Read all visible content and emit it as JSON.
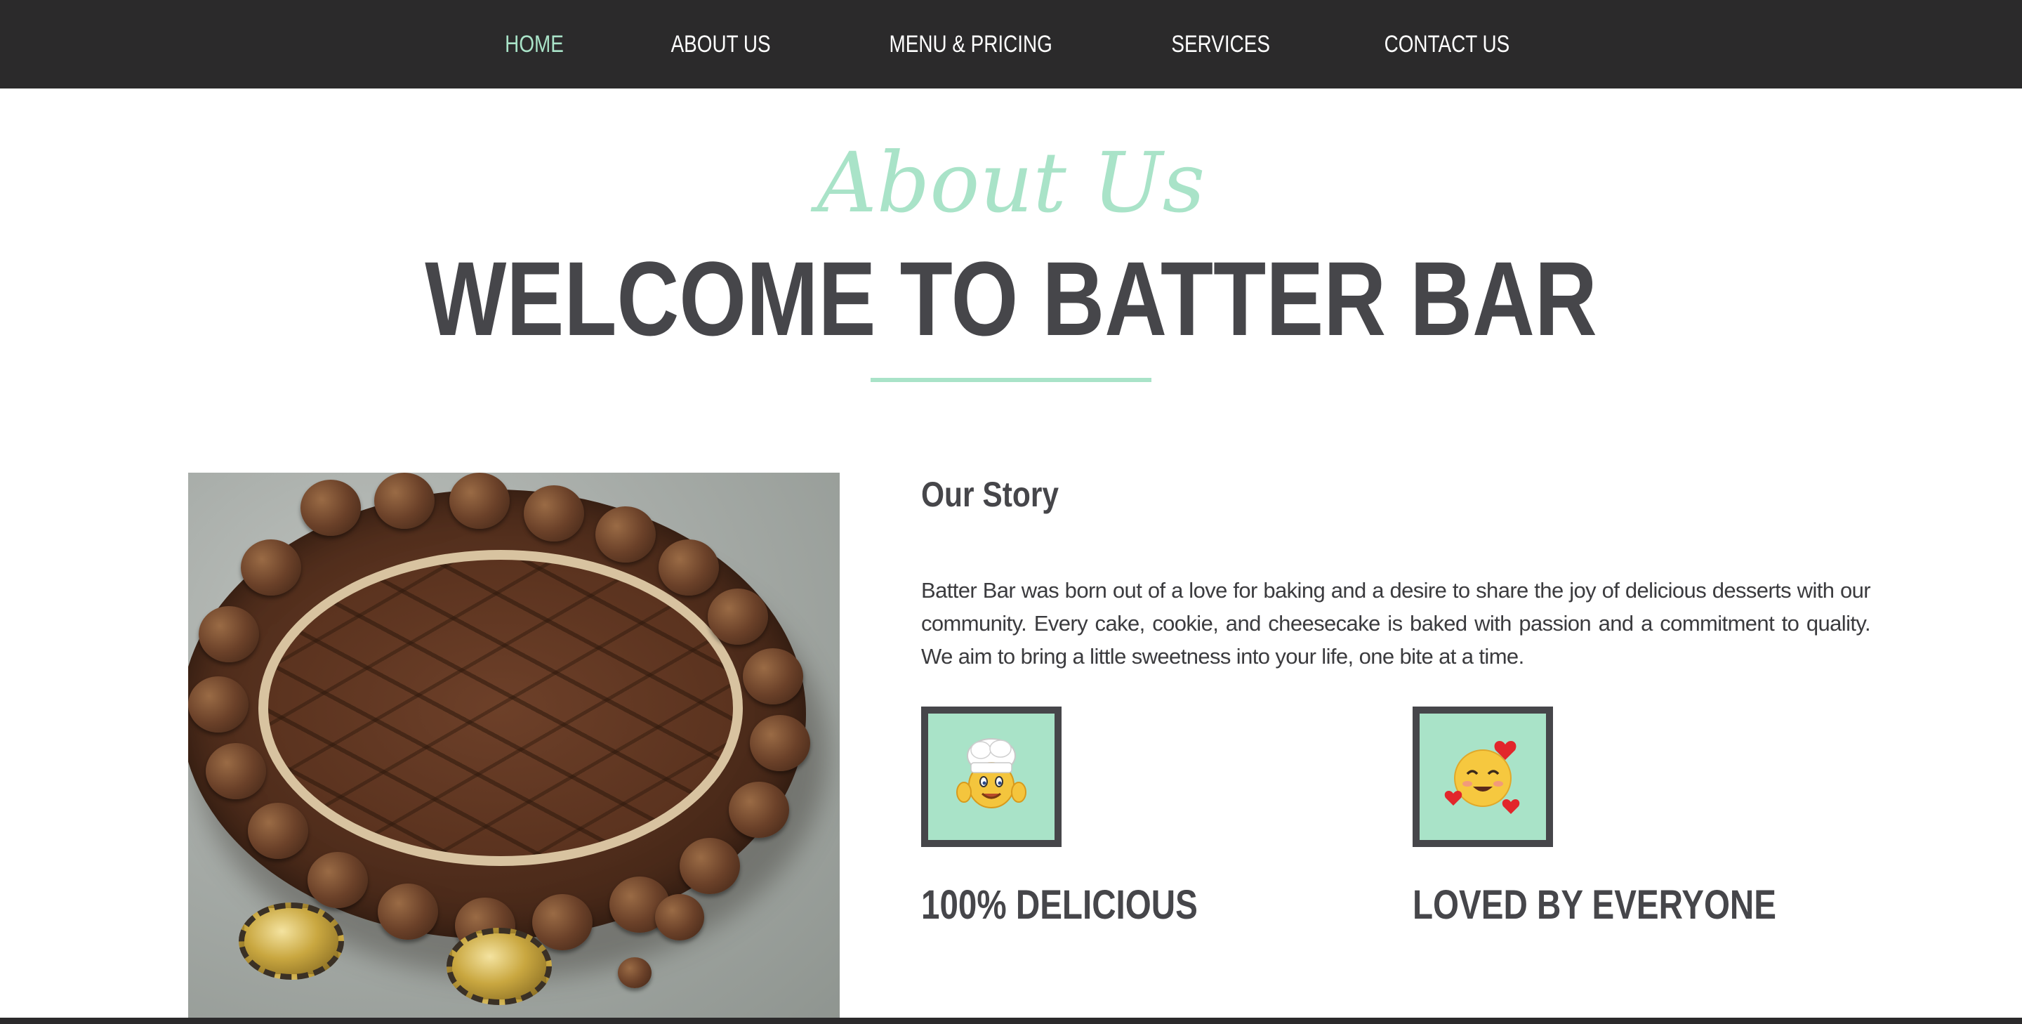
{
  "nav": {
    "items": [
      {
        "label": "HOME",
        "active": true
      },
      {
        "label": "ABOUT US",
        "active": false
      },
      {
        "label": "MENU & PRICING",
        "active": false
      },
      {
        "label": "SERVICES",
        "active": false
      },
      {
        "label": "CONTACT US",
        "active": false
      }
    ]
  },
  "hero": {
    "script_title": "About Us",
    "main_title": "WELCOME TO BATTER BAR"
  },
  "story": {
    "title": "Our Story",
    "text": "Batter Bar was born out of a love for baking and a desire to share the joy of delicious desserts with our community. Every cake, cookie, and cheesecake is baked with passion and a commitment to quality. We aim to bring a little sweetness into your life, one bite at a time."
  },
  "features": [
    {
      "label": "100% DELICIOUS",
      "icon": "chef-emoji-icon"
    },
    {
      "label": "LOVED BY EVERYONE",
      "icon": "smiling-hearts-emoji-icon"
    }
  ],
  "colors": {
    "accent": "#a9e3c8",
    "nav_background": "#2b2a2b",
    "heading_text": "#46464a"
  }
}
